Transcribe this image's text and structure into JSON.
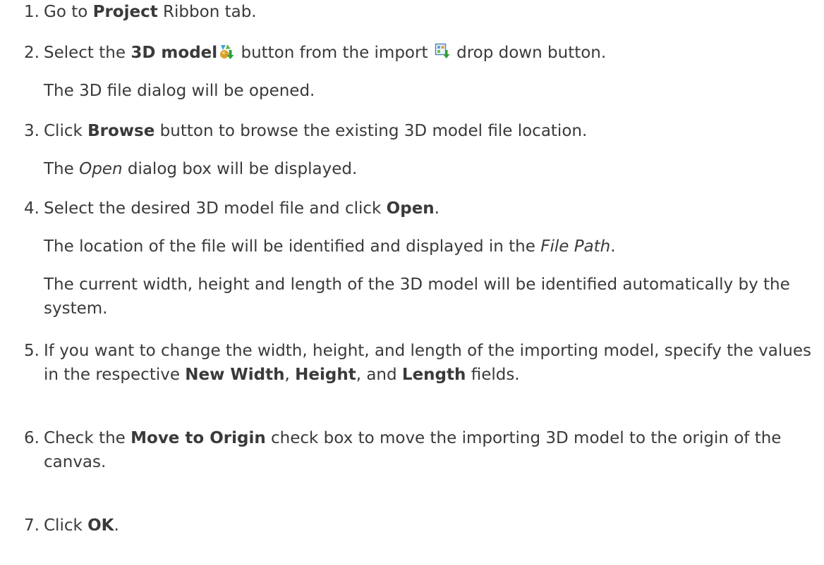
{
  "steps": [
    {
      "num": "1.",
      "lines": [
        {
          "t1": "Go to ",
          "b1": "Project",
          "t2": " Ribbon tab."
        }
      ]
    },
    {
      "num": "2.",
      "lines": [
        {
          "t1": "Select the ",
          "b1": "3D model",
          "t2": " button from the import ",
          "t3": " drop down button."
        },
        {
          "t1": "The 3D file dialog will be opened."
        }
      ],
      "icons": [
        "3d-model-icon",
        "import-icon"
      ]
    },
    {
      "num": "3.",
      "lines": [
        {
          "t1": "Click ",
          "b1": "Browse",
          "t2": " button to browse the existing 3D model file location."
        },
        {
          "t1": "The ",
          "i1": "Open",
          "t2": " dialog box will be displayed."
        }
      ]
    },
    {
      "num": "4.",
      "lines": [
        {
          "t1": "Select the desired 3D model file and click ",
          "b1": "Open",
          "t2": "."
        },
        {
          "t1": "The location of the file will be identified and displayed in the ",
          "i1": "File Path",
          "t2": "."
        },
        {
          "t1": "The current width, height and length of  the 3D model will be identified automatically by the system."
        }
      ]
    },
    {
      "num": "5.",
      "lines": [
        {
          "t1": "If you want to change the width, height, and length of the importing model, specify the values in the respective ",
          "b1": "New Width",
          "t2": ", ",
          "b2": "Height",
          "t3": ", and ",
          "b3": "Length",
          "t4": " fields."
        }
      ]
    },
    {
      "num": "6.",
      "lines": [
        {
          "t1": "Check the ",
          "b1": "Move to Origin",
          "t2": " check box to move the importing 3D model to the origin of the canvas."
        }
      ]
    },
    {
      "num": "7.",
      "lines": [
        {
          "t1": "Click ",
          "b1": "OK",
          "t2": "."
        }
      ]
    }
  ]
}
